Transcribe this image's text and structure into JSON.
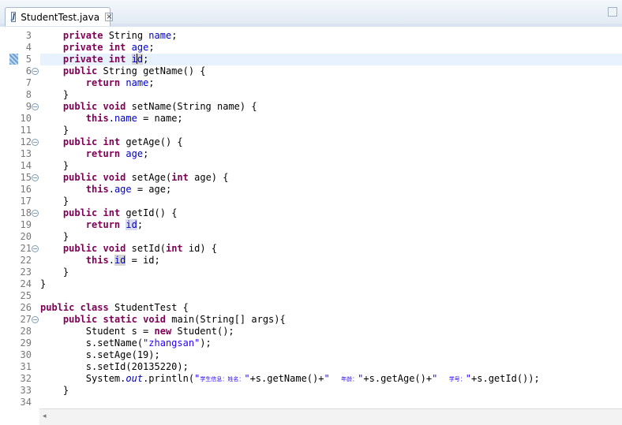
{
  "tab": {
    "title": "StudentTest.java",
    "icon": "java-file-icon",
    "close_glyph": "×"
  },
  "editor": {
    "current_line": 5,
    "lines": [
      {
        "n": "3",
        "fold": false,
        "html": "    <span class=\"k\">private</span> String <span class=\"f\">name</span>;"
      },
      {
        "n": "4",
        "fold": false,
        "html": "    <span class=\"k\">private</span> <span class=\"k\">int</span> <span class=\"f\">age</span>;"
      },
      {
        "n": "5",
        "fold": false,
        "html": "    <span class=\"k\">private</span> <span class=\"k\">int</span> <span class=\"f occ\">i<span class=\"caret\"></span>d</span>;"
      },
      {
        "n": "6",
        "fold": true,
        "html": "    <span class=\"k\">public</span> String getName() {"
      },
      {
        "n": "7",
        "fold": false,
        "html": "        <span class=\"k\">return</span> <span class=\"f\">name</span>;"
      },
      {
        "n": "8",
        "fold": false,
        "html": "    }"
      },
      {
        "n": "9",
        "fold": true,
        "html": "    <span class=\"k\">public</span> <span class=\"k\">void</span> setName(String name) {"
      },
      {
        "n": "10",
        "fold": false,
        "html": "        <span class=\"k\">this</span>.<span class=\"f\">name</span> = name;"
      },
      {
        "n": "11",
        "fold": false,
        "html": "    }"
      },
      {
        "n": "12",
        "fold": true,
        "html": "    <span class=\"k\">public</span> <span class=\"k\">int</span> getAge() {"
      },
      {
        "n": "13",
        "fold": false,
        "html": "        <span class=\"k\">return</span> <span class=\"f\">age</span>;"
      },
      {
        "n": "14",
        "fold": false,
        "html": "    }"
      },
      {
        "n": "15",
        "fold": true,
        "html": "    <span class=\"k\">public</span> <span class=\"k\">void</span> setAge(<span class=\"k\">int</span> age) {"
      },
      {
        "n": "16",
        "fold": false,
        "html": "        <span class=\"k\">this</span>.<span class=\"f\">age</span> = age;"
      },
      {
        "n": "17",
        "fold": false,
        "html": "    }"
      },
      {
        "n": "18",
        "fold": true,
        "html": "    <span class=\"k\">public</span> <span class=\"k\">int</span> getId() {"
      },
      {
        "n": "19",
        "fold": false,
        "html": "        <span class=\"k\">return</span> <span class=\"f hl\">id</span>;"
      },
      {
        "n": "20",
        "fold": false,
        "html": "    }"
      },
      {
        "n": "21",
        "fold": true,
        "html": "    <span class=\"k\">public</span> <span class=\"k\">void</span> setId(<span class=\"k\">int</span> id) {"
      },
      {
        "n": "22",
        "fold": false,
        "html": "        <span class=\"k\">this</span>.<span class=\"f occ\">id</span> = id;"
      },
      {
        "n": "23",
        "fold": false,
        "html": "    }"
      },
      {
        "n": "24",
        "fold": false,
        "html": "}"
      },
      {
        "n": "25",
        "fold": false,
        "html": ""
      },
      {
        "n": "26",
        "fold": false,
        "html": "<span class=\"k\">public</span> <span class=\"k\">class</span> StudentTest {"
      },
      {
        "n": "27",
        "fold": true,
        "html": "    <span class=\"k\">public</span> <span class=\"k\">static</span> <span class=\"k\">void</span> main(String[] args){"
      },
      {
        "n": "28",
        "fold": false,
        "html": "        Student s = <span class=\"k\">new</span> Student();"
      },
      {
        "n": "29",
        "fold": false,
        "html": "        s.setName(<span class=\"s\">\"zhangsan\"</span>);"
      },
      {
        "n": "30",
        "fold": false,
        "html": "        s.setAge(19);"
      },
      {
        "n": "31",
        "fold": false,
        "html": "        s.setId(20135220);"
      },
      {
        "n": "32",
        "fold": false,
        "html": "        System.<span class=\"i\">out</span>.println(<span class=\"s\">\"<span class=\"cn\">学生信息：姓名：</span>\"</span>+s.getName()+<span class=\"s\">\"  <span class=\"cn\">年龄：</span>\"</span>+s.getAge()+<span class=\"s\">\"  <span class=\"cn\">学号：</span>\"</span>+s.getId());"
      },
      {
        "n": "33",
        "fold": false,
        "html": "    }"
      },
      {
        "n": "34",
        "fold": false,
        "html": ""
      }
    ]
  },
  "scrollbar": {
    "left_arrow": "◂"
  }
}
